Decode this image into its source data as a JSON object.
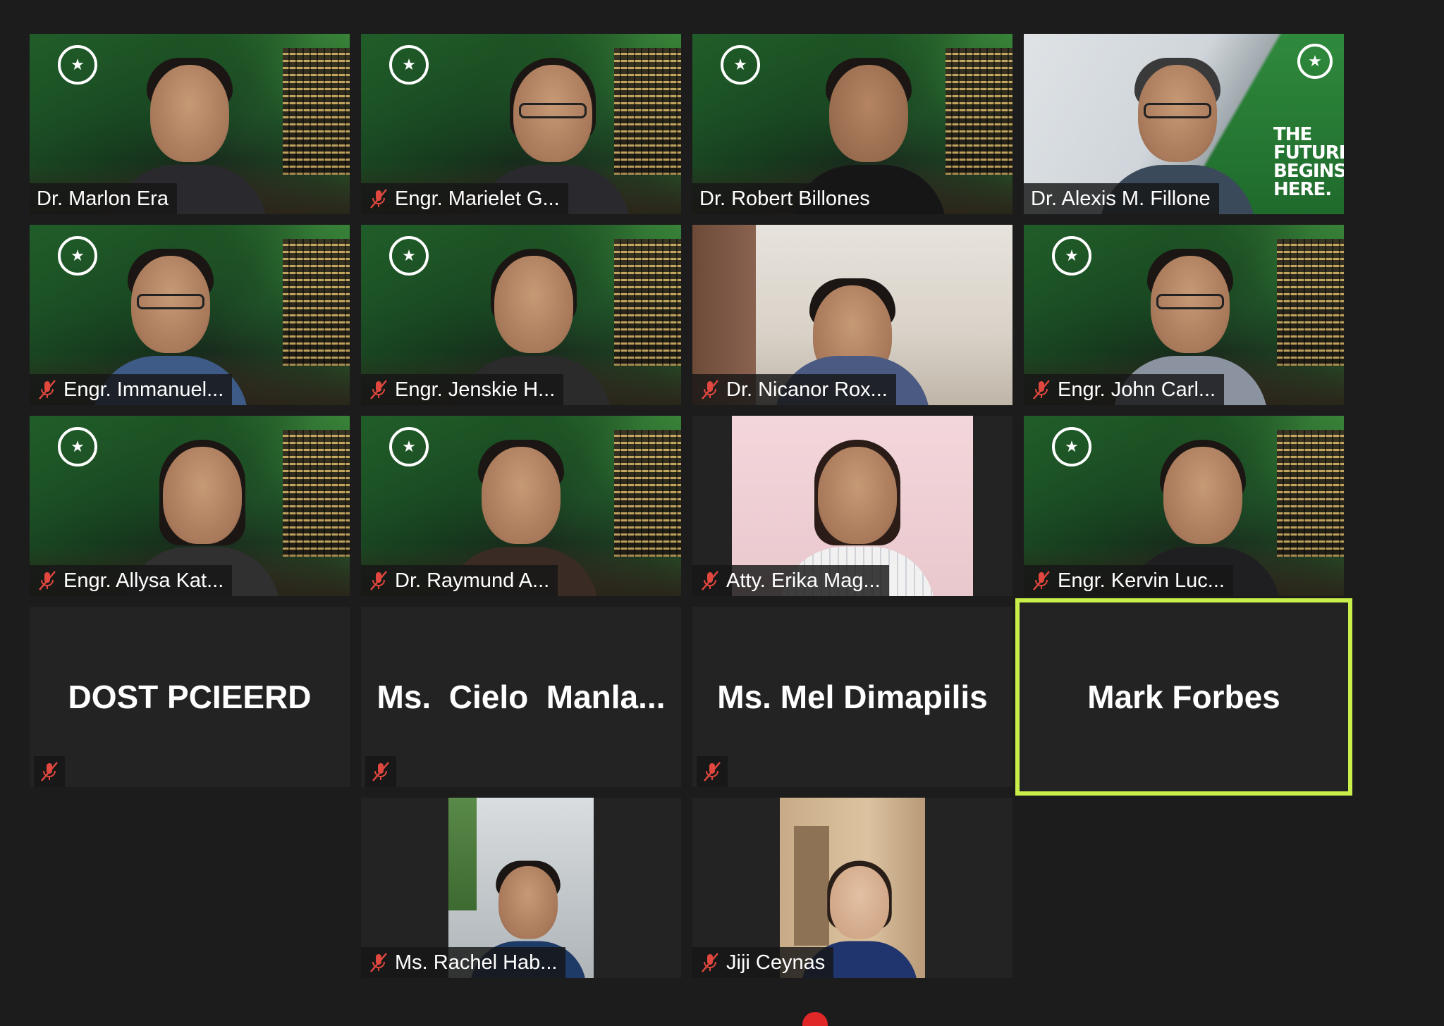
{
  "meeting": {
    "participants": [
      {
        "id": "p1",
        "name": "Dr. Marlon Era",
        "muted": false,
        "background": "green"
      },
      {
        "id": "p2",
        "name": "Engr. Marielet G...",
        "muted": true,
        "background": "green"
      },
      {
        "id": "p3",
        "name": "Dr. Robert Billones",
        "muted": false,
        "background": "green"
      },
      {
        "id": "p4",
        "name": "Dr. Alexis M. Fillone",
        "muted": false,
        "background": "campus",
        "banner": "THE FUTURE BEGINS HERE."
      },
      {
        "id": "p5",
        "name": "Engr. Immanuel...",
        "muted": true,
        "background": "green"
      },
      {
        "id": "p6",
        "name": "Engr. Jenskie H...",
        "muted": true,
        "background": "green"
      },
      {
        "id": "p7",
        "name": "Dr. Nicanor Rox...",
        "muted": true,
        "background": "room"
      },
      {
        "id": "p8",
        "name": "Engr. John Carl...",
        "muted": true,
        "background": "green"
      },
      {
        "id": "p9",
        "name": "Engr. Allysa Kat...",
        "muted": true,
        "background": "green"
      },
      {
        "id": "p10",
        "name": "Dr. Raymund A...",
        "muted": true,
        "background": "green"
      },
      {
        "id": "p11",
        "name": "Atty. Erika Mag...",
        "muted": true,
        "background": "pink"
      },
      {
        "id": "p12",
        "name": "Engr. Kervin Luc...",
        "muted": true,
        "background": "green"
      },
      {
        "id": "p13",
        "name": "DOST PCIEERD",
        "muted": true,
        "video": false
      },
      {
        "id": "p14",
        "name": "Ms.  Cielo  Manla...",
        "muted": true,
        "video": false
      },
      {
        "id": "p15",
        "name": "Ms. Mel Dimapilis",
        "muted": true,
        "video": false
      },
      {
        "id": "p16",
        "name": "Mark Forbes",
        "muted": false,
        "video": false,
        "active_speaker": true
      },
      {
        "id": "p17",
        "name": "Ms. Rachel Hab...",
        "muted": true,
        "background": "office"
      },
      {
        "id": "p18",
        "name": "Jiji Ceynas",
        "muted": true,
        "background": "door"
      }
    ]
  },
  "icons": {
    "mute": "microphone-muted-icon",
    "seal": "university-seal-icon"
  },
  "colors": {
    "mute_red": "#e0473f",
    "active_border": "#c9ef4a",
    "background": "#1c1c1c",
    "tile": "#232323"
  }
}
